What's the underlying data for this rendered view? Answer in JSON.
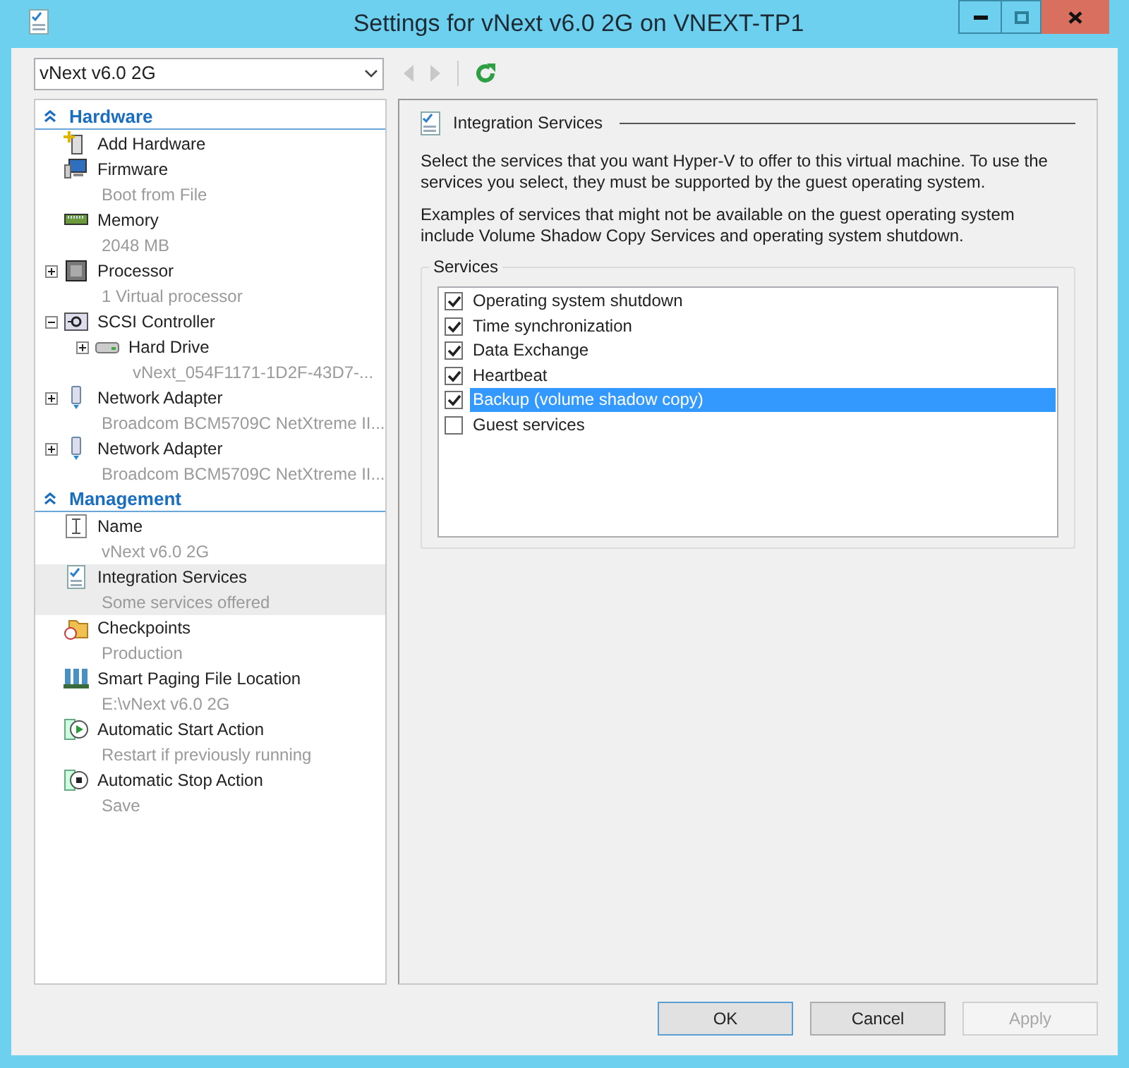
{
  "window": {
    "title": "Settings for vNext v6.0 2G on VNEXT-TP1"
  },
  "vm_selector": {
    "value": "vNext v6.0 2G"
  },
  "sidebar": {
    "sections": [
      {
        "title": "Hardware",
        "expanded": true,
        "items": [
          {
            "kind": "add-hardware",
            "label": "Add Hardware",
            "selected": false
          },
          {
            "kind": "firmware",
            "label": "Firmware",
            "subtitle": "Boot from File",
            "selected": false
          },
          {
            "kind": "memory",
            "label": "Memory",
            "subtitle": "2048 MB",
            "selected": false
          },
          {
            "kind": "processor",
            "label": "Processor",
            "subtitle": "1 Virtual processor",
            "expanded": false,
            "selected": false
          },
          {
            "kind": "scsi",
            "label": "SCSI Controller",
            "expanded": true,
            "selected": false,
            "children": [
              {
                "kind": "disk",
                "label": "Hard Drive",
                "subtitle": "vNext_054F1171-1D2F-43D7-...",
                "expanded": false,
                "selected": false
              }
            ]
          },
          {
            "kind": "network",
            "label": "Network Adapter",
            "subtitle": "Broadcom BCM5709C NetXtreme II...",
            "expanded": false,
            "selected": false
          },
          {
            "kind": "network",
            "label": "Network Adapter",
            "subtitle": "Broadcom BCM5709C NetXtreme II...",
            "expanded": false,
            "selected": false
          }
        ]
      },
      {
        "title": "Management",
        "expanded": true,
        "items": [
          {
            "kind": "name",
            "label": "Name",
            "subtitle": "vNext v6.0 2G",
            "selected": false
          },
          {
            "kind": "integration",
            "label": "Integration Services",
            "subtitle": "Some services offered",
            "selected": true
          },
          {
            "kind": "checkpoint",
            "label": "Checkpoints",
            "subtitle": "Production",
            "selected": false
          },
          {
            "kind": "paging",
            "label": "Smart Paging File Location",
            "subtitle": "E:\\vNext v6.0 2G",
            "selected": false
          },
          {
            "kind": "start",
            "label": "Automatic Start Action",
            "subtitle": "Restart if previously running",
            "selected": false
          },
          {
            "kind": "stop",
            "label": "Automatic Stop Action",
            "subtitle": "Save",
            "selected": false
          }
        ]
      }
    ]
  },
  "panel": {
    "title": "Integration Services",
    "paragraphs": [
      "Select the services that you want Hyper-V to offer to this virtual machine. To use the services you select, they must be supported by the guest operating system.",
      "Examples of services that might not be available on the guest operating system include Volume Shadow Copy Services and operating system shutdown."
    ],
    "services_label": "Services",
    "services": [
      {
        "label": "Operating system shutdown",
        "checked": true,
        "selected": false
      },
      {
        "label": "Time synchronization",
        "checked": true,
        "selected": false
      },
      {
        "label": "Data Exchange",
        "checked": true,
        "selected": false
      },
      {
        "label": "Heartbeat",
        "checked": true,
        "selected": false
      },
      {
        "label": "Backup (volume shadow copy)",
        "checked": true,
        "selected": true
      },
      {
        "label": "Guest services",
        "checked": false,
        "selected": false
      }
    ]
  },
  "buttons": [
    {
      "label": "OK",
      "disabled": false
    },
    {
      "label": "Cancel",
      "disabled": false
    },
    {
      "label": "Apply",
      "disabled": true
    }
  ]
}
